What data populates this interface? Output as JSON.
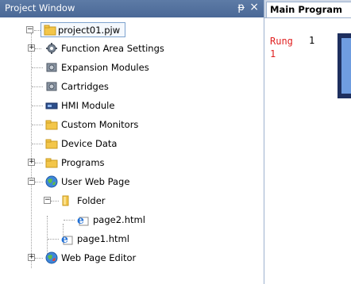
{
  "project_window": {
    "title": "Project Window",
    "pin_glyph": "ᵽ",
    "close_glyph": "×"
  },
  "tree": {
    "root": {
      "label": "project01.pjw",
      "icon": "project-folder-icon",
      "expander": "−"
    },
    "items": [
      {
        "label": "Function Area Settings",
        "icon": "gear-settings-icon",
        "expander": "+"
      },
      {
        "label": "Expansion Modules",
        "icon": "module-gear-icon",
        "expander": ""
      },
      {
        "label": "Cartridges",
        "icon": "cartridge-gear-icon",
        "expander": ""
      },
      {
        "label": "HMI Module",
        "icon": "hmi-module-icon",
        "expander": ""
      },
      {
        "label": "Custom Monitors",
        "icon": "folder-icon",
        "expander": ""
      },
      {
        "label": "Device Data",
        "icon": "folder-icon",
        "expander": ""
      },
      {
        "label": "Programs",
        "icon": "folder-icon",
        "expander": "+"
      },
      {
        "label": "User Web Page",
        "icon": "globe-icon",
        "expander": "−"
      },
      {
        "label": "Folder",
        "icon": "folder-open-icon",
        "expander": "−"
      },
      {
        "label": "page2.html",
        "icon": "ie-file-icon",
        "expander": ""
      },
      {
        "label": "page1.html",
        "icon": "ie-file-icon",
        "expander": ""
      },
      {
        "label": "Web Page Editor",
        "icon": "globe-edit-icon",
        "expander": "+"
      }
    ]
  },
  "main": {
    "tab_label": "Main Program",
    "rung_label": "Rung\n1",
    "rung_number": "1"
  },
  "colors": {
    "title_bar": "#4a6896",
    "rung_text": "#e02020",
    "folder": "#f3c64a",
    "selection_border": "#7da2ce"
  }
}
